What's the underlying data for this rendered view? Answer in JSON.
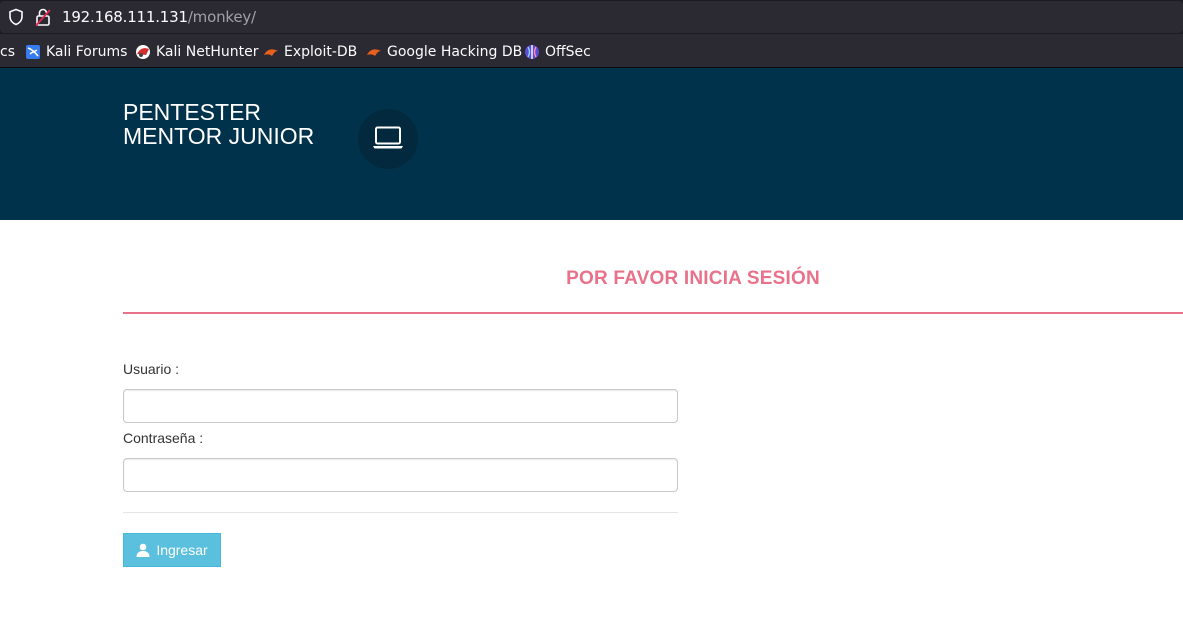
{
  "browser": {
    "url_host": "192.168.111.131",
    "url_path": "/monkey/",
    "bookmarks": [
      {
        "label": "cs",
        "icon": "none"
      },
      {
        "label": "Kali Forums",
        "icon": "kali-forums-icon"
      },
      {
        "label": "Kali NetHunter",
        "icon": "kali-nethunter-icon"
      },
      {
        "label": "Exploit-DB",
        "icon": "exploit-db-icon"
      },
      {
        "label": "Google Hacking DB",
        "icon": "google-hacking-db-icon"
      },
      {
        "label": "OffSec",
        "icon": "offsec-icon"
      }
    ]
  },
  "header": {
    "brand_line1": "PENTESTER",
    "brand_line2": "MENTOR JUNIOR",
    "icon": "laptop-icon",
    "background_color": "#00324b"
  },
  "login": {
    "title": "POR FAVOR INICIA SESIÓN",
    "accent_color": "#e8728a",
    "username_label": "Usuario :",
    "username_value": "",
    "password_label": "Contraseña :",
    "password_value": "",
    "submit_label": "Ingresar",
    "submit_icon": "user-icon",
    "submit_color": "#5bc0de"
  }
}
